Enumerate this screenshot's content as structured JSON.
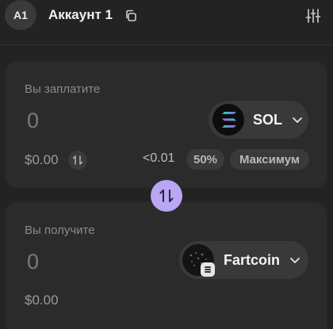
{
  "header": {
    "avatar_text": "A1",
    "account_name": "Аккаунт 1"
  },
  "pay": {
    "label": "Вы заплатите",
    "amount": "0",
    "usd": "$0.00",
    "token": "SOL",
    "balance": "<0.01",
    "half_label": "50%",
    "max_label": "Максимум"
  },
  "receive": {
    "label": "Вы получите",
    "amount": "0",
    "usd": "$0.00",
    "token": "Fartcoin"
  },
  "colors": {
    "accent": "#b9a6f5",
    "card": "#2b2b2b",
    "background": "#232323"
  }
}
